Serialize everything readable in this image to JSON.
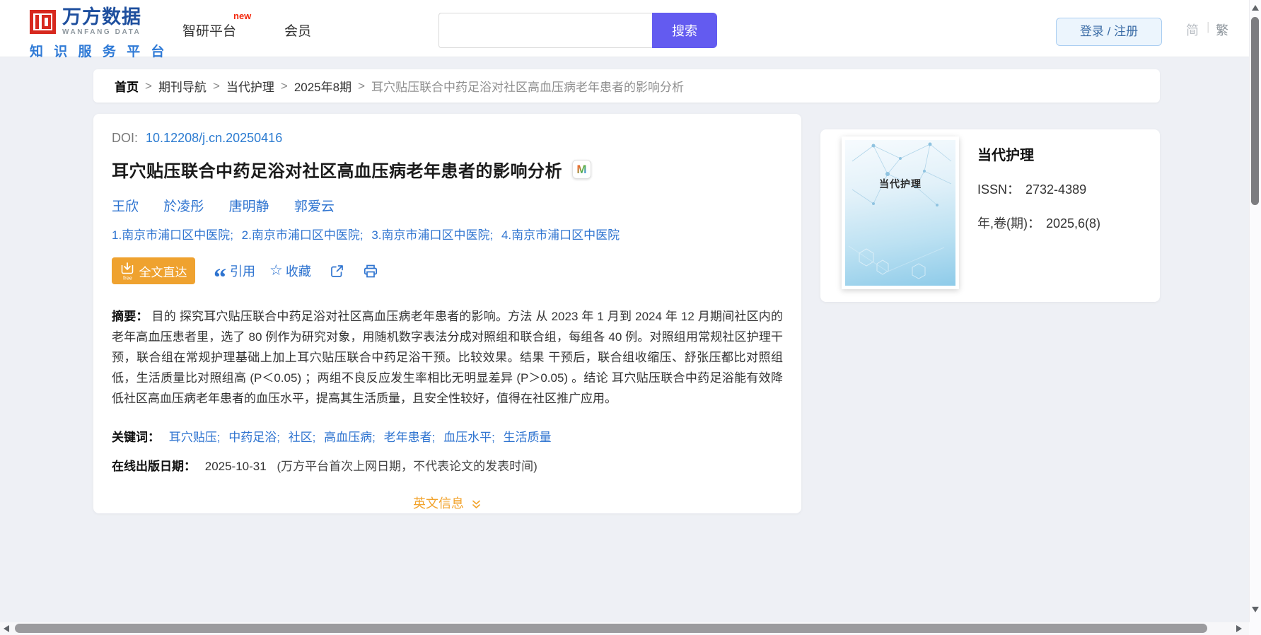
{
  "colors": {
    "page_bg": "#eef0f5",
    "accent_purple": "#635bf0",
    "brand_red": "#d7281e",
    "brand_blue": "#1e4f9e",
    "tagline_blue": "#2f7ad6",
    "link_blue": "#2f74d0",
    "fulltext_orange": "#efa22f",
    "english_orange": "#f2a32c"
  },
  "header": {
    "logo": {
      "cn": "万方数据",
      "en": "WANFANG DATA",
      "tagline": "知 识 服 务 平 台"
    },
    "nav": [
      {
        "label": "智研平台",
        "badge": "new"
      },
      {
        "label": "会员"
      }
    ],
    "search": {
      "value": "",
      "placeholder": "",
      "button": "搜索"
    },
    "login_label": "登录 / 注册",
    "lang_simplified": "简",
    "lang_divider": "|",
    "lang_traditional": "繁"
  },
  "breadcrumb": {
    "separator": ">",
    "items": [
      "首页",
      "期刊导航",
      "当代护理",
      "2025年8期",
      "耳穴贴压联合中药足浴对社区高血压病老年患者的影响分析"
    ]
  },
  "article": {
    "doi_label": "DOI:",
    "doi": "10.12208/j.cn.20250416",
    "title": "耳穴贴压联合中药足浴对社区高血压病老年患者的影响分析",
    "badge": "M",
    "authors": [
      "王欣",
      "於凌彤",
      "唐明静",
      "郭爱云"
    ],
    "affiliations": [
      {
        "num": "1.",
        "name": "南京市浦口区中医院"
      },
      {
        "num": "2.",
        "name": "南京市浦口区中医院"
      },
      {
        "num": "3.",
        "name": "南京市浦口区中医院"
      },
      {
        "num": "4.",
        "name": "南京市浦口区中医院"
      }
    ],
    "aff_sep": ";",
    "actions": {
      "fulltext": "全文直达",
      "fulltext_sub": "free",
      "cite": "引用",
      "favorite": "收藏"
    },
    "abstract_label": "摘要：",
    "abstract": "目的 探究耳穴贴压联合中药足浴对社区高血压病老年患者的影响。方法 从 2023 年 1 月到 2024 年 12 月期间社区内的老年高血压患者里，选了 80 例作为研究对象，用随机数字表法分成对照组和联合组，每组各 40 例。对照组用常规社区护理干预，联合组在常规护理基础上加上耳穴贴压联合中药足浴干预。比较效果。结果 干预后，联合组收缩压、舒张压都比对照组低，生活质量比对照组高 (P＜0.05) ；两组不良反应发生率相比无明显差异 (P＞0.05) 。结论 耳穴贴压联合中药足浴能有效降低社区高血压病老年患者的血压水平，提高其生活质量，且安全性较好，值得在社区推广应用。",
    "keywords_label": "关键词：",
    "keywords": [
      "耳穴贴压",
      "中药足浴",
      "社区",
      "高血压病",
      "老年患者",
      "血压水平",
      "生活质量"
    ],
    "keyword_sep": ";",
    "pubdate_label": "在线出版日期：",
    "pubdate": "2025-10-31",
    "pubdate_note": "(万方平台首次上网日期，不代表论文的发表时间)",
    "english_info": "英文信息"
  },
  "journal": {
    "cover_title": "当代护理",
    "name": "当代护理",
    "issn_label": "ISSN：",
    "issn": "2732-4389",
    "vol_label": "年,卷(期)：",
    "vol": "2025,6(8)"
  }
}
